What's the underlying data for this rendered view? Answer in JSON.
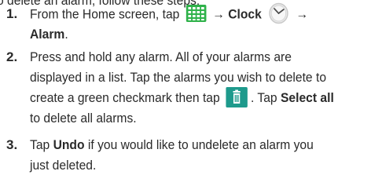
{
  "intro": "o delete an alarm, follow these steps:",
  "steps": [
    {
      "number": "1.",
      "parts": {
        "t1": "From the Home screen, tap",
        "arrow1": "→",
        "clock": "Clock",
        "arrow2": "→",
        "alarm": "Alarm",
        "end": "."
      },
      "icons": [
        "apps-grid-icon",
        "clock-icon"
      ]
    },
    {
      "number": "2.",
      "parts": {
        "l1": "Press and hold any alarm. All of your alarms are",
        "l2": "displayed in a list. Tap the alarms you wish to delete to",
        "l3a": "create a green checkmark then tap",
        "l3b": ". Tap",
        "select_all": "Select all",
        "l4": "to delete all alarms."
      },
      "icons": [
        "trash-icon"
      ]
    },
    {
      "number": "3.",
      "parts": {
        "t1": "Tap",
        "undo": "Undo",
        "t2": "if you would like to undelete an alarm you",
        "l2": "just deleted."
      }
    }
  ],
  "colors": {
    "text": "#2a2a2a",
    "apps_icon": "#2fb24a",
    "trash_icon": "#1e9a8c",
    "clock_face": "#e9e9e9"
  }
}
